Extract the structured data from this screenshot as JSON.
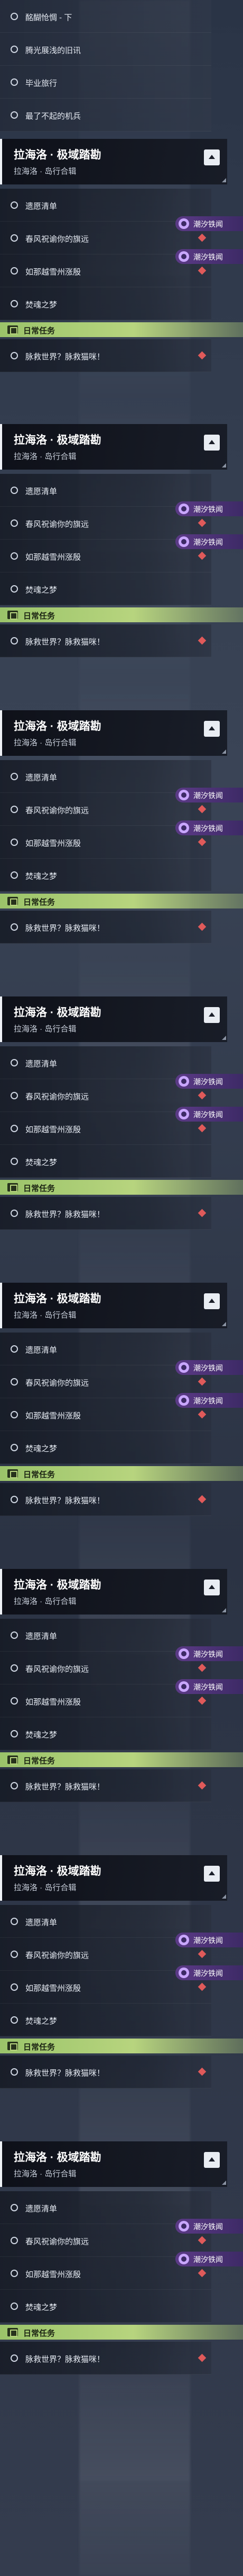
{
  "top_rows": [
    {
      "label": "酩醐怆惆 - 下"
    },
    {
      "label": "腾光展浅的旧讯"
    },
    {
      "label": "毕业旅行"
    },
    {
      "label": "最了不起的机兵"
    }
  ],
  "sections": [
    {
      "title": "拉海洛 · 极域踏勘",
      "subtitle": "拉海洛 · 岛行合辑",
      "rows": [
        "遗愿清单",
        "春风祝谕你的旗远",
        "如那越雪州涨殷",
        "焚魂之梦"
      ],
      "badge": "潮汐铁闻",
      "daily_title": "日常任务",
      "daily_row": "脉救世界？脉救猫咪！"
    },
    {
      "title": "拉海洛 · 极域踏勘",
      "subtitle": "拉海洛 · 岛行合辑",
      "rows": [
        "遗愿清单",
        "春风祝谕你的旗远",
        "如那越雪州涨殷",
        "焚魂之梦"
      ],
      "badge": "潮汐铁闻",
      "daily_title": "日常任务",
      "daily_row": "脉救世界？脉救猫咪！"
    },
    {
      "title": "拉海洛 · 极域踏勘",
      "subtitle": "拉海洛 · 岛行合辑",
      "rows": [
        "遗愿清单",
        "春风祝谕你的旗远",
        "如那越雪州涨殷",
        "焚魂之梦"
      ],
      "badge": "潮汐铁闻",
      "daily_title": "日常任务",
      "daily_row": "脉救世界？脉救猫咪！"
    },
    {
      "title": "拉海洛 · 极域踏勘",
      "subtitle": "拉海洛 · 岛行合辑",
      "rows": [
        "遗愿清单",
        "春风祝谕你的旗远",
        "如那越雪州涨殷",
        "焚魂之梦"
      ],
      "badge": "潮汐铁闻",
      "daily_title": "日常任务",
      "daily_row": "脉救世界？脉救猫咪！"
    },
    {
      "title": "拉海洛 · 极域踏勘",
      "subtitle": "拉海洛 · 岛行合辑",
      "rows": [
        "遗愿清单",
        "春风祝谕你的旗远",
        "如那越雪州涨殷",
        "焚魂之梦"
      ],
      "badge": "潮汐铁闻",
      "daily_title": "日常任务",
      "daily_row": "脉救世界？脉救猫咪！"
    },
    {
      "title": "拉海洛 · 极域踏勘",
      "subtitle": "拉海洛 · 岛行合辑",
      "rows": [
        "遗愿清单",
        "春风祝谕你的旗远",
        "如那越雪州涨殷",
        "焚魂之梦"
      ],
      "badge": "潮汐铁闻",
      "daily_title": "日常任务",
      "daily_row": "脉救世界？脉救猫咪！"
    },
    {
      "title": "拉海洛 · 极域踏勘",
      "subtitle": "拉海洛 · 岛行合辑",
      "rows": [
        "遗愿清单",
        "春风祝谕你的旗远",
        "如那越雪州涨殷",
        "焚魂之梦"
      ],
      "badge": "潮汐铁闻",
      "daily_title": "日常任务",
      "daily_row": "脉救世界？脉救猫咪！"
    },
    {
      "title": "拉海洛 · 极域踏勘",
      "subtitle": "拉海洛 · 岛行合辑",
      "rows": [
        "遗愿清单",
        "春风祝谕你的旗远",
        "如那越雪州涨殷",
        "焚魂之梦"
      ],
      "badge": "潮汐铁闻",
      "daily_title": "日常任务",
      "daily_row": "脉救世界？脉救猫咪！"
    }
  ],
  "first_section_extra_row": "最了不起的机兵",
  "colors": {
    "badge": "#5b3a86",
    "daily": "#b7d47e",
    "marker": "#e05a5a",
    "header": "#0c0e16"
  },
  "icons": {
    "collapse": "chevron-up-icon",
    "badge": "event-icon",
    "daily": "daily-task-icon",
    "quest": "circle-icon",
    "marker": "diamond-marker-icon"
  }
}
